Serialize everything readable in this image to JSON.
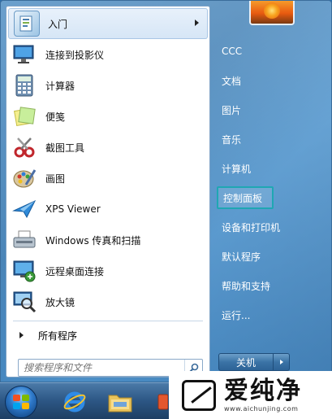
{
  "start_menu": {
    "programs": [
      {
        "label": "入门",
        "icon": "getting-started-icon",
        "has_submenu": true
      },
      {
        "label": "连接到投影仪",
        "icon": "projector-icon"
      },
      {
        "label": "计算器",
        "icon": "calculator-icon"
      },
      {
        "label": "便笺",
        "icon": "sticky-notes-icon"
      },
      {
        "label": "截图工具",
        "icon": "snipping-tool-icon"
      },
      {
        "label": "画图",
        "icon": "paint-icon"
      },
      {
        "label": "XPS Viewer",
        "icon": "xps-viewer-icon"
      },
      {
        "label": "Windows 传真和扫描",
        "icon": "fax-scan-icon"
      },
      {
        "label": "远程桌面连接",
        "icon": "remote-desktop-icon"
      },
      {
        "label": "放大镜",
        "icon": "magnifier-icon"
      }
    ],
    "all_programs_label": "所有程序",
    "search_placeholder": "搜索程序和文件",
    "right_items": [
      {
        "label": "CCC"
      },
      {
        "label": "文档"
      },
      {
        "label": "图片"
      },
      {
        "label": "音乐"
      },
      {
        "label": "计算机"
      },
      {
        "label": "控制面板",
        "highlighted": true
      },
      {
        "label": "设备和打印机"
      },
      {
        "label": "默认程序"
      },
      {
        "label": "帮助和支持"
      },
      {
        "label": "运行..."
      }
    ],
    "shutdown_label": "关机"
  },
  "watermark": {
    "name": "爱纯净",
    "url": "www.aichunjing.com"
  }
}
